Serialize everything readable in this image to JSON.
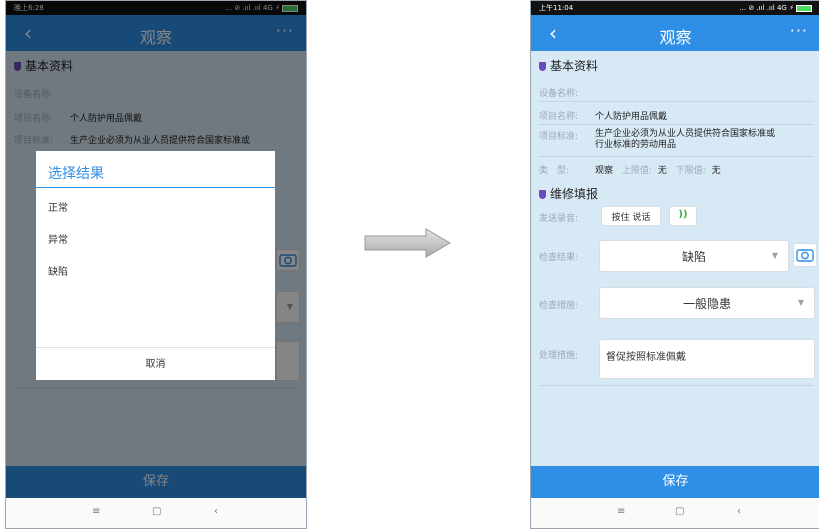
{
  "left_screen": {
    "status": {
      "time": "晚上6:28",
      "signal": "... ⊘ .ııl .ııl 4G ⚡"
    },
    "app_title": "观察",
    "back_icon": "‹",
    "more_icon": "···",
    "section_basic": "基本资料",
    "device_label": "设备名称:",
    "item_name_label": "项目名称:",
    "item_name_value": "个人防护用品佩戴",
    "item_std_label": "项目标准:",
    "item_std_value": "生产企业必须为从业人员提供符合国家标准或",
    "dialog": {
      "title": "选择结果",
      "options": [
        "正常",
        "异常",
        "缺陷"
      ],
      "cancel": "取消"
    },
    "save": "保存",
    "nav": [
      "≡",
      "▢",
      "‹"
    ]
  },
  "right_screen": {
    "status": {
      "time": "上午11:04",
      "signal": "... ⊘ .ııl .ııl 4G ⚡"
    },
    "app_title": "观察",
    "back_icon": "‹",
    "more_icon": "···",
    "section_basic": "基本资料",
    "device_label": "设备名称:",
    "item_name_label": "项目名称:",
    "item_name_value": "个人防护用品佩戴",
    "item_std_label": "项目标准:",
    "item_std_value_1": "生产企业必须为从业人员提供符合国家标准或",
    "item_std_value_2": "行业标准的劳动用品",
    "type_label": "类　型:",
    "type_value": "观察",
    "upper_label": "上限值:",
    "upper_value": "无",
    "lower_label": "下限值:",
    "lower_value": "无",
    "section_repair": "维修填报",
    "voice_label": "发送录音:",
    "voice_button": "按住 说话",
    "voice_icon": "))",
    "check_result_label": "检查结果:",
    "check_result_value": "缺陷",
    "check_measure_label": "检查措施:",
    "check_measure_value": "一般隐患",
    "handle_label": "处理措施:",
    "handle_value": "督促按照标准佩戴",
    "save": "保存",
    "nav": [
      "≡",
      "▢",
      "‹"
    ]
  }
}
